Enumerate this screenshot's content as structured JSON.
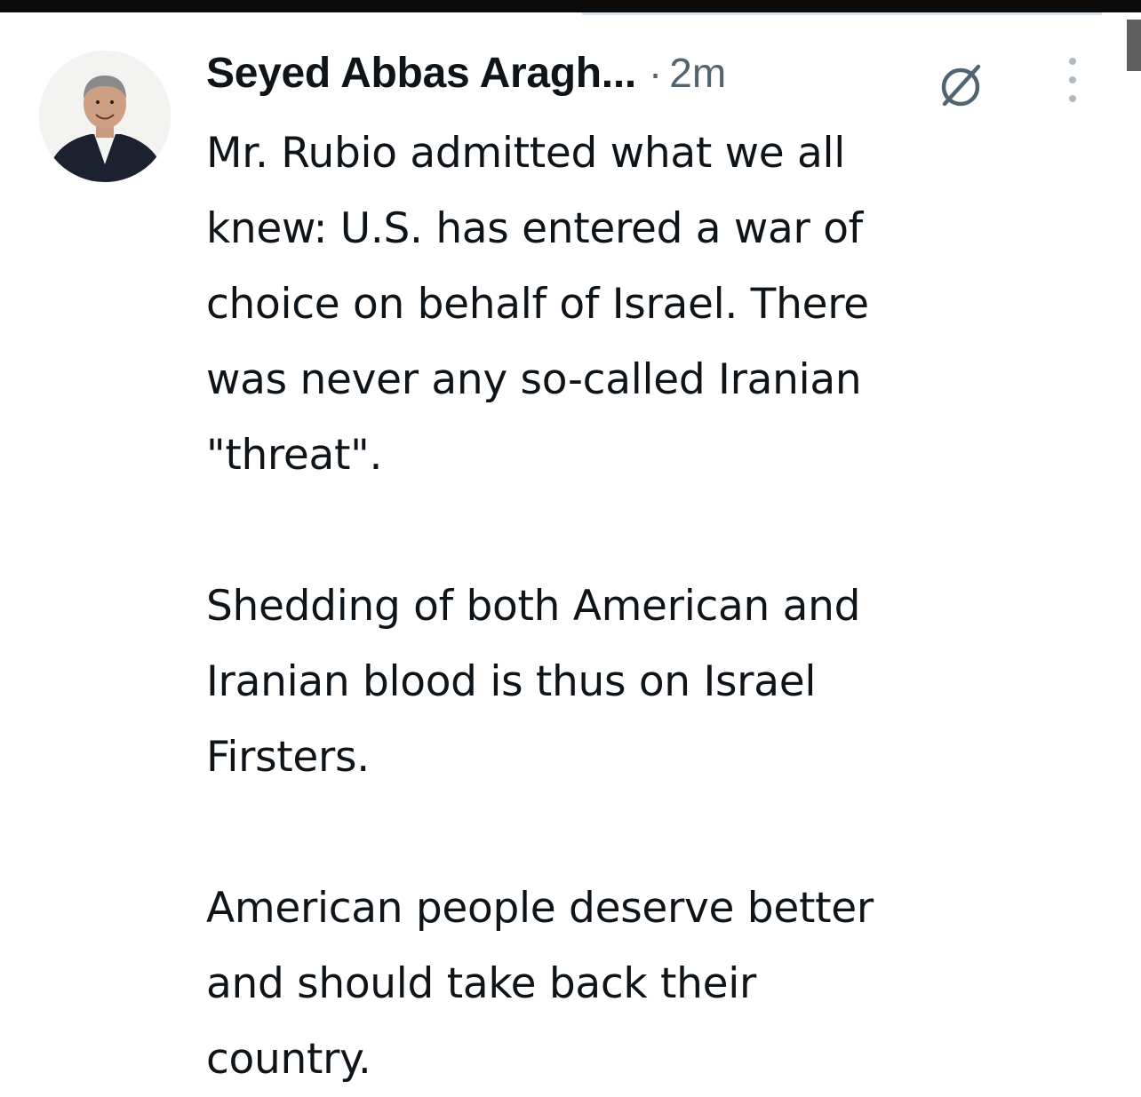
{
  "tweet": {
    "author_name": "Seyed Abbas Aragh...",
    "separator": "·",
    "time": "2m",
    "paragraphs": [
      "Mr. Rubio admitted what we all\nknew: U.S. has entered a war of\nchoice on behalf of Israel. There\nwas never any so-called Iranian\n\"threat\".",
      "Shedding of both American and\nIranian blood is thus on Israel\nFirsters.",
      "American people deserve better\nand should take back their\ncountry."
    ]
  },
  "icons": {
    "grok": "grok-icon",
    "more": "more-options-icon",
    "avatar": "profile-photo"
  },
  "colors": {
    "text": "#0f1419",
    "muted": "#536471",
    "background": "#ffffff"
  }
}
